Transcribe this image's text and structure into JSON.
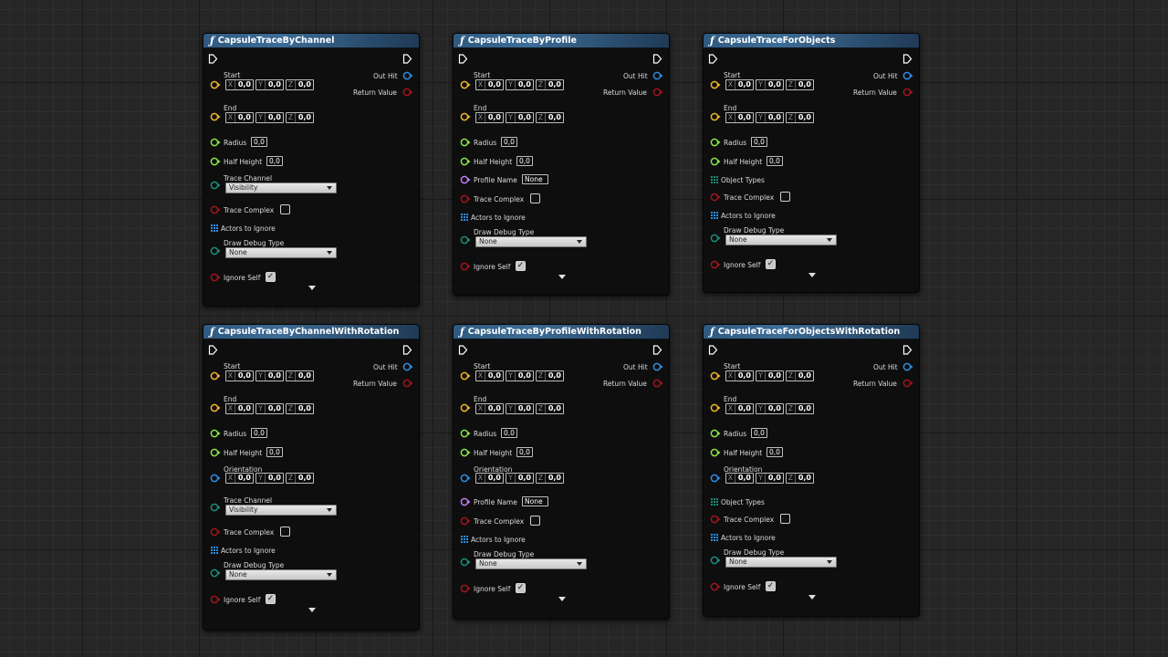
{
  "colors": {
    "exec": "#ffffff",
    "vector": "#f0b428",
    "float": "#86e24c",
    "struct": "#2c8de0",
    "bool": "#a0141a",
    "byte_enum": "#1a8c7a",
    "name": "#c07bf0",
    "header": "#3d6c96"
  },
  "node_labels": {
    "out_hit": "Out Hit",
    "return_value": "Return Value",
    "start": "Start",
    "end": "End",
    "radius": "Radius",
    "half_height": "Half Height",
    "orientation": "Orientation",
    "trace_channel": "Trace Channel",
    "profile_name": "Profile Name",
    "object_types": "Object Types",
    "trace_complex": "Trace Complex",
    "actors_to_ignore": "Actors to Ignore",
    "draw_debug_type": "Draw Debug Type",
    "ignore_self": "Ignore Self",
    "axis_x": "X",
    "axis_y": "Y",
    "axis_z": "Z",
    "vec_value": "0,0",
    "float_value": "0,0",
    "profile_value": "None",
    "trace_channel_value": "Visibility",
    "debug_value": "None",
    "check": "✓"
  },
  "nodes": [
    {
      "title": "CapsuleTraceByChannel",
      "variant": "channel",
      "rotation": false
    },
    {
      "title": "CapsuleTraceByProfile",
      "variant": "profile",
      "rotation": false
    },
    {
      "title": "CapsuleTraceForObjects",
      "variant": "objects",
      "rotation": false
    },
    {
      "title": "CapsuleTraceByChannelWithRotation",
      "variant": "channel",
      "rotation": true
    },
    {
      "title": "CapsuleTraceByProfileWithRotation",
      "variant": "profile",
      "rotation": true
    },
    {
      "title": "CapsuleTraceForObjectsWithRotation",
      "variant": "objects",
      "rotation": true
    }
  ]
}
